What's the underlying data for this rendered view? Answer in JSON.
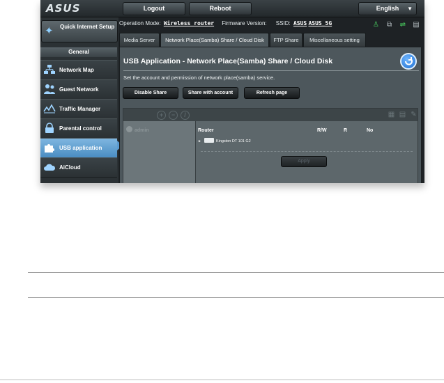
{
  "header": {
    "logo": "ASUS",
    "logout_label": "Logout",
    "reboot_label": "Reboot",
    "language": "English"
  },
  "info": {
    "operation_mode_label": "Operation Mode:",
    "operation_mode_value": "Wireless router",
    "firmware_label": "Firmware Version:",
    "ssid_label": "SSID:",
    "ssid_1": "ASUS",
    "ssid_2": "ASUS_5G"
  },
  "sidebar": {
    "quick_setup": "Quick Internet Setup",
    "section": "General",
    "items": [
      {
        "label": "Network Map",
        "icon": "network-map-icon"
      },
      {
        "label": "Guest Network",
        "icon": "guest-network-icon"
      },
      {
        "label": "Traffic Manager",
        "icon": "traffic-manager-icon"
      },
      {
        "label": "Parental control",
        "icon": "lock-icon"
      },
      {
        "label": "USB application",
        "icon": "puzzle-icon",
        "active": true
      },
      {
        "label": "AiCloud",
        "icon": "cloud-icon"
      }
    ]
  },
  "tabs": [
    {
      "label": "Media Server"
    },
    {
      "label": "Network Place(Samba) Share / Cloud Disk",
      "active": true
    },
    {
      "label": "FTP Share"
    },
    {
      "label": "Miscellaneous setting"
    }
  ],
  "panel": {
    "title": "USB Application - Network Place(Samba) Share / Cloud Disk",
    "description": "Set the account and permission of network place(samba) service.",
    "buttons": {
      "disable_share": "Disable Share",
      "share_with_account": "Share with account",
      "refresh_page": "Refresh page"
    }
  },
  "share_table": {
    "user": "admin",
    "columns": {
      "location": "Router",
      "rw": "R/W",
      "r": "R",
      "no": "No"
    },
    "disk": "Kingston DT 101 G2",
    "apply_label": "Apply"
  },
  "colors": {
    "accent": "#4a8dc2",
    "status_green": "#4cd964"
  }
}
